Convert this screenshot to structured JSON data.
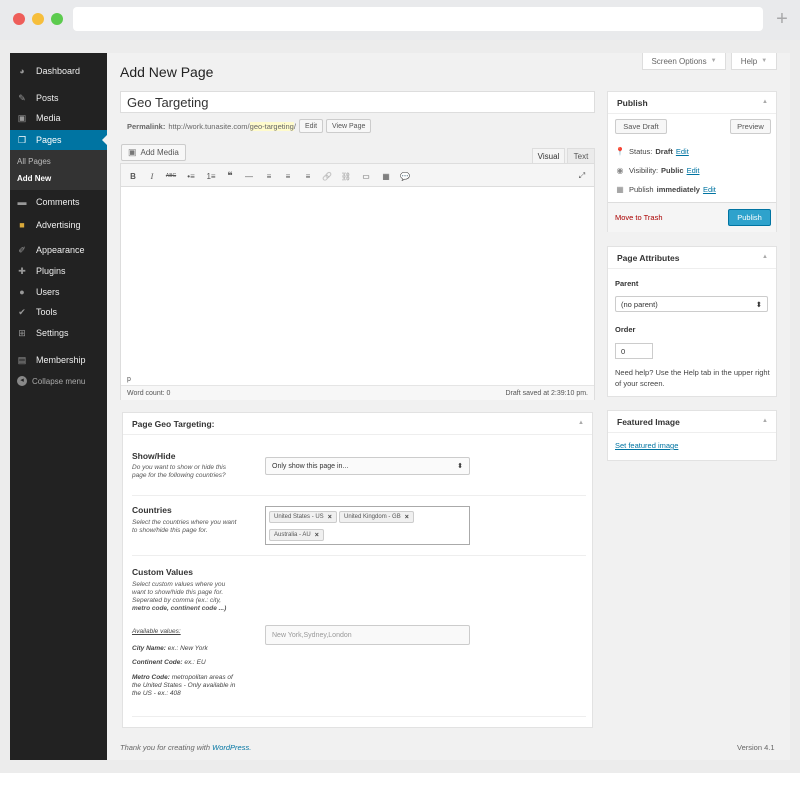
{
  "browser": {
    "new_tab": "+"
  },
  "sidebar": {
    "items": [
      {
        "label": "Dashboard",
        "icon": "dashboard-icon"
      },
      {
        "label": "Posts",
        "icon": "pin-icon"
      },
      {
        "label": "Media",
        "icon": "media-icon"
      },
      {
        "label": "Pages",
        "icon": "pages-icon"
      },
      {
        "label": "Comments",
        "icon": "comment-icon"
      },
      {
        "label": "Advertising",
        "icon": "folder-icon"
      },
      {
        "label": "Appearance",
        "icon": "brush-icon"
      },
      {
        "label": "Plugins",
        "icon": "plug-icon"
      },
      {
        "label": "Users",
        "icon": "user-icon"
      },
      {
        "label": "Tools",
        "icon": "wrench-icon"
      },
      {
        "label": "Settings",
        "icon": "settings-icon"
      },
      {
        "label": "Membership",
        "icon": "membership-icon"
      }
    ],
    "submenu": [
      "All Pages",
      "Add New"
    ],
    "collapse": "Collapse menu"
  },
  "header": {
    "screen_options": "Screen Options",
    "help": "Help",
    "title": "Add New Page"
  },
  "post": {
    "title": "Geo Targeting",
    "permalink_label": "Permalink:",
    "permalink_base": "http://work.tunasite.com/",
    "permalink_slug": "geo-targeting",
    "permalink_trail": "/",
    "edit": "Edit",
    "view_page": "View Page"
  },
  "editor": {
    "add_media": "Add Media",
    "tab_visual": "Visual",
    "tab_text": "Text",
    "toolbar": [
      "B",
      "I",
      "ABC",
      "•≡",
      "1≡",
      "❝",
      "—",
      "≡",
      "≡",
      "≡",
      "🔗",
      "⛓",
      "▭",
      "▦",
      "💬",
      "⤢"
    ],
    "path": "p",
    "word_count": "Word count: 0",
    "draft_saved": "Draft saved at 2:39:10 pm."
  },
  "geo": {
    "title": "Page Geo Targeting:",
    "show_hide": {
      "title": "Show/Hide",
      "desc": [
        "Do you want to show or hide this",
        "page for the following countries?"
      ],
      "selected": "Only show this page in..."
    },
    "countries": {
      "title": "Countries",
      "desc": [
        "Select the countries where you want",
        "to show/hide this page for."
      ],
      "chips": [
        "United States - US",
        "United Kingdom - GB",
        "Australia - AU"
      ]
    },
    "custom": {
      "title": "Custom Values",
      "desc": [
        "Select custom values where you",
        "want to show/hide this page for.",
        "Seperated by comma (ex.: city,",
        "metro code, continent code ...)"
      ],
      "placeholder": "New York,Sydney,London",
      "available": "Available values:",
      "city_label": "City Name:",
      "city_value": "ex.: New York",
      "continent_label": "Continent Code:",
      "continent_value": "ex.: EU",
      "metro_label": "Metro Code:",
      "metro_value": [
        "metropolitan areas of",
        "the United States - Only available in",
        "the US - ex.: 408"
      ]
    }
  },
  "publish": {
    "title": "Publish",
    "save_draft": "Save Draft",
    "preview": "Preview",
    "status_label": "Status:",
    "status_value": "Draft",
    "visibility_label": "Visibility:",
    "visibility_value": "Public",
    "schedule_label": "Publish",
    "schedule_value": "immediately",
    "edit": "Edit",
    "trash": "Move to Trash",
    "publish": "Publish"
  },
  "attributes": {
    "title": "Page Attributes",
    "parent_label": "Parent",
    "parent_value": "(no parent)",
    "order_label": "Order",
    "order_value": "0",
    "help": "Need help? Use the Help tab in the upper right of your screen."
  },
  "featured": {
    "title": "Featured Image",
    "link": "Set featured image"
  },
  "footer": {
    "thanks": "Thank you for creating with",
    "wp": "WordPress.",
    "version": "Version 4.1"
  },
  "colors": {
    "admin_bar": "#222222",
    "accent": "#0074a2",
    "publish": "#2ea2cc",
    "trash": "#aa0000"
  }
}
